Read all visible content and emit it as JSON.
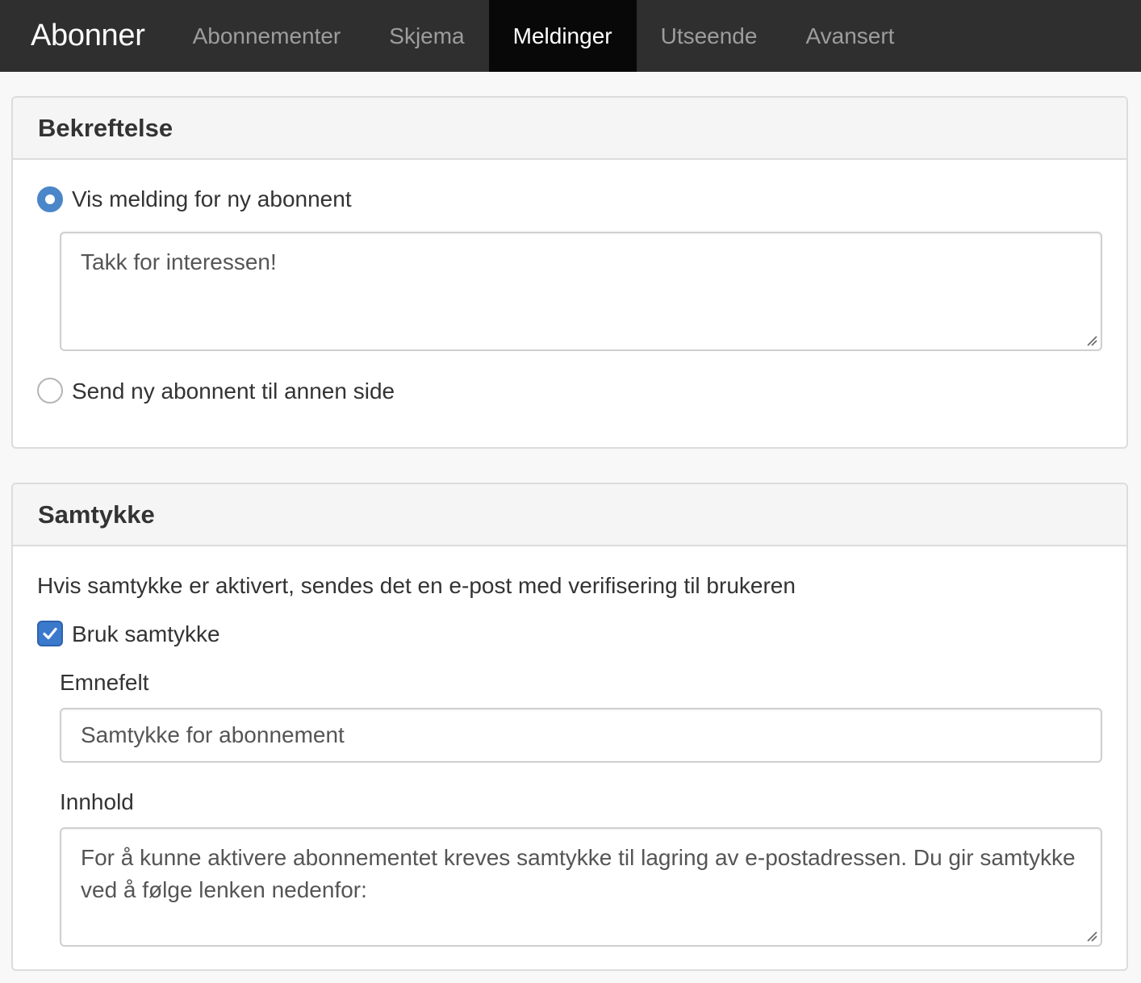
{
  "navbar": {
    "brand": "Abonner",
    "tabs": [
      {
        "label": "Abonnementer",
        "active": false
      },
      {
        "label": "Skjema",
        "active": false
      },
      {
        "label": "Meldinger",
        "active": true
      },
      {
        "label": "Utseende",
        "active": false
      },
      {
        "label": "Avansert",
        "active": false
      }
    ]
  },
  "confirmation": {
    "title": "Bekreftelse",
    "option_message": {
      "label": "Vis melding for ny abonnent",
      "selected": true
    },
    "message_text": "Takk for interessen!",
    "option_redirect": {
      "label": "Send ny abonnent til annen side",
      "selected": false
    }
  },
  "consent": {
    "title": "Samtykke",
    "description": "Hvis samtykke er aktivert, sendes det en e-post med verifisering til brukeren",
    "use_consent": {
      "label": "Bruk samtykke",
      "checked": true
    },
    "subject_label": "Emnefelt",
    "subject_value": "Samtykke for abonnement",
    "content_label": "Innhold",
    "content_value": "For å kunne aktivere abonnementet kreves samtykke til lagring av e-postadressen. Du gir samtykke ved å følge lenken nedenfor:"
  },
  "colors": {
    "navbar_bg": "#2f2f2f",
    "active_tab_bg": "#080808",
    "accent": "#4a86c8"
  }
}
